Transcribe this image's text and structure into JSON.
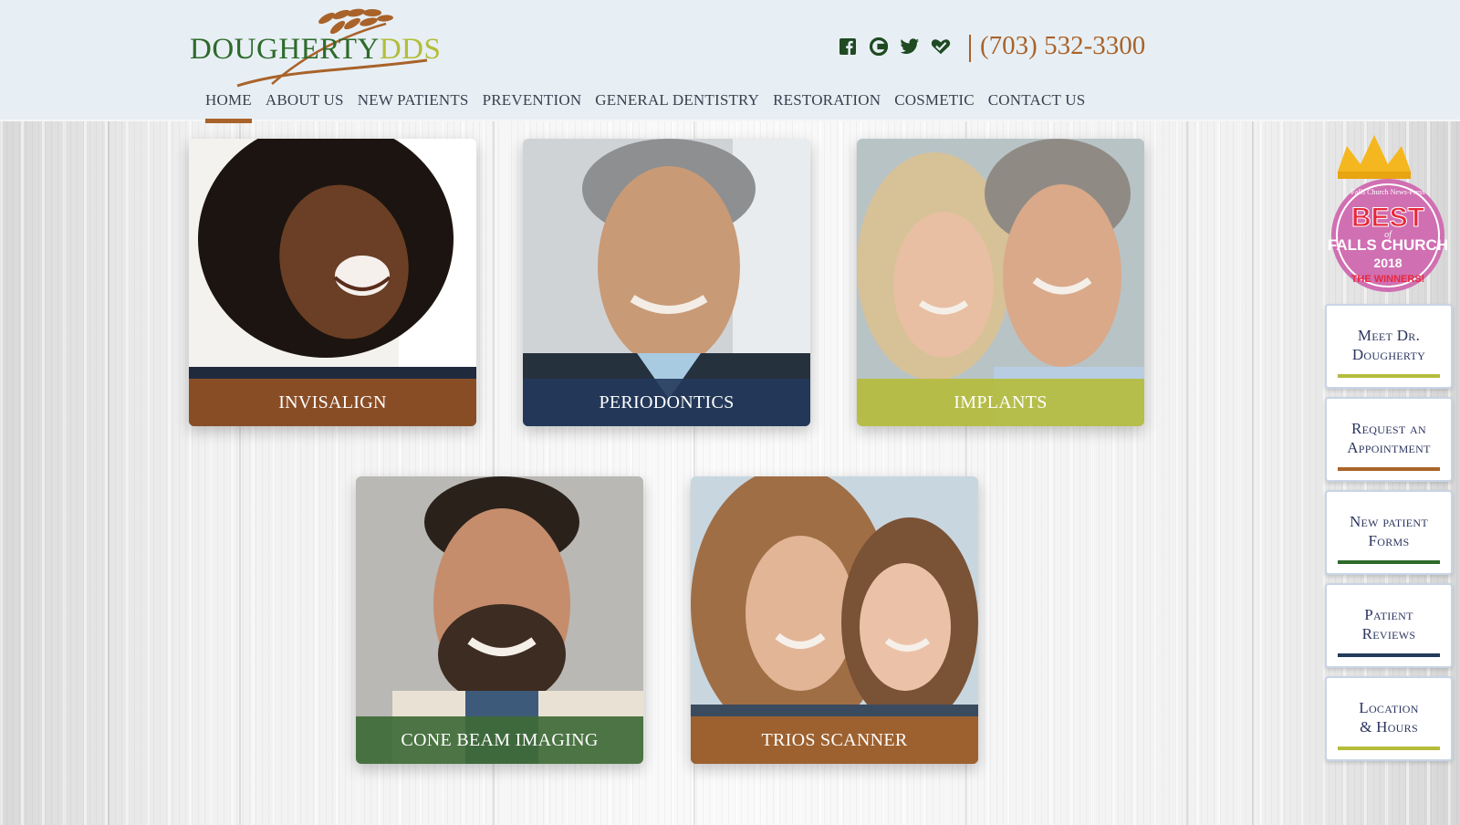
{
  "logo": {
    "part1": "DOUGHERTY",
    "part2": "DDS"
  },
  "social": [
    "facebook-icon",
    "google-icon",
    "twitter-icon",
    "healthgrades-icon"
  ],
  "phone": "(703) 532-3300",
  "nav": [
    {
      "label": "HOME",
      "active": true
    },
    {
      "label": "ABOUT US"
    },
    {
      "label": "NEW PATIENTS"
    },
    {
      "label": "PREVENTION"
    },
    {
      "label": "GENERAL DENTISTRY"
    },
    {
      "label": "RESTORATION"
    },
    {
      "label": "COSMETIC"
    },
    {
      "label": "CONTACT US"
    }
  ],
  "cards": [
    {
      "label": "INVISALIGN",
      "color": "#9c5322"
    },
    {
      "label": "PERIODONTICS",
      "color": "#233a5c"
    },
    {
      "label": "IMPLANTS",
      "color": "#b5bd3a"
    },
    {
      "label": "CONE BEAM IMAGING",
      "color": "#3e6a37"
    },
    {
      "label": "TRIOS SCANNER",
      "color": "#a8642a"
    }
  ],
  "badge": {
    "publisher": "Falls Church News-Press",
    "line1": "BEST",
    "line2": "of",
    "line3": "FALLS CHURCH",
    "year": "2018",
    "line4": "THE WINNERS!"
  },
  "sidebar": [
    {
      "label": "Meet Dr.",
      "label2": "Dougherty",
      "color": "#b5bd3a"
    },
    {
      "label": "Request an",
      "label2": "Appointment",
      "color": "#a8642a"
    },
    {
      "label": "New patient",
      "label2": "Forms",
      "color": "#2d6a2a"
    },
    {
      "label": "Patient",
      "label2": "Reviews",
      "color": "#233a5c"
    },
    {
      "label": "Location",
      "label2": "& Hours",
      "color": "#b5bd3a"
    }
  ],
  "colors": {
    "accent": "#a9632a",
    "header_bg": "#e7eff4",
    "nav_text": "#3a3f4e"
  }
}
